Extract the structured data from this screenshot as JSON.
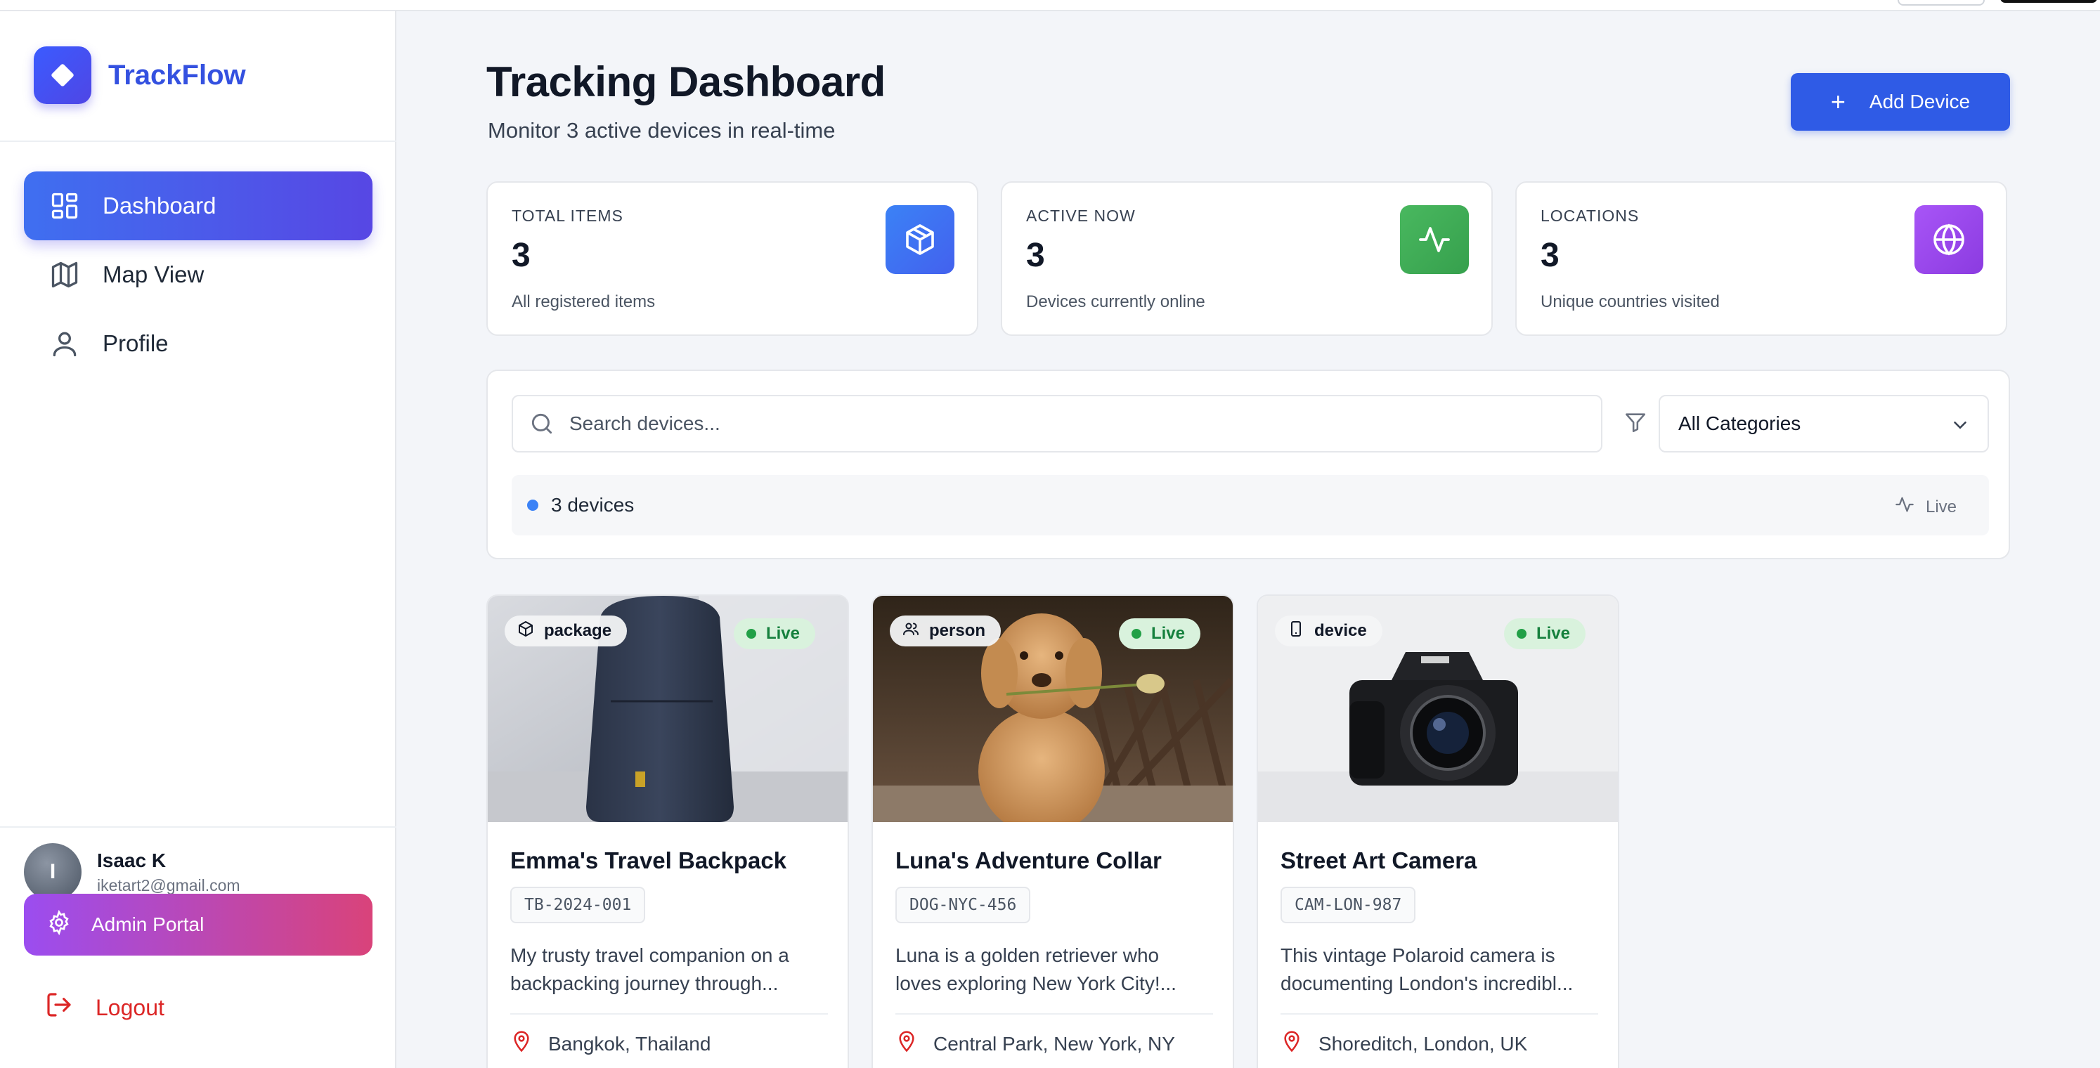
{
  "app": {
    "name": "TrackFlow"
  },
  "sidebar": {
    "items": [
      {
        "label": "Dashboard",
        "icon": "dashboard-grid-icon",
        "active": true
      },
      {
        "label": "Map View",
        "icon": "map-icon",
        "active": false
      },
      {
        "label": "Profile",
        "icon": "user-icon",
        "active": false
      }
    ],
    "user": {
      "initial": "I",
      "name": "Isaac K",
      "email": "iketart2@gmail.com"
    },
    "admin_label": "Admin Portal",
    "logout_label": "Logout"
  },
  "header": {
    "title": "Tracking Dashboard",
    "subtitle": "Monitor 3 active devices in real-time",
    "add_label": "Add Device"
  },
  "stats": [
    {
      "label": "TOTAL ITEMS",
      "value": "3",
      "desc": "All registered items",
      "icon": "package-icon",
      "color": "#3b6ff0"
    },
    {
      "label": "ACTIVE NOW",
      "value": "3",
      "desc": "Devices currently online",
      "icon": "activity-icon",
      "color": "#3fae57"
    },
    {
      "label": "LOCATIONS",
      "value": "3",
      "desc": "Unique countries visited",
      "icon": "globe-icon",
      "color": "#9d45e8"
    }
  ],
  "filters": {
    "search_placeholder": "Search devices...",
    "category": "All Categories",
    "count_text": "3 devices",
    "live_text": "Live"
  },
  "devices": [
    {
      "category": "package",
      "status": "Live",
      "title": "Emma's Travel Backpack",
      "code": "TB-2024-001",
      "desc_line1": "My trusty travel companion on a",
      "desc_line2": "backpacking journey through...",
      "location": "Bangkok, Thailand"
    },
    {
      "category": "person",
      "status": "Live",
      "title": "Luna's Adventure Collar",
      "code": "DOG-NYC-456",
      "desc_line1": "Luna is a golden retriever who",
      "desc_line2": "loves exploring New York City!...",
      "location": "Central Park, New York, NY"
    },
    {
      "category": "device",
      "status": "Live",
      "title": "Street Art Camera",
      "code": "CAM-LON-987",
      "desc_line1": "This vintage Polaroid camera is",
      "desc_line2": "documenting London's incredibl...",
      "location": "Shoreditch, London, UK"
    }
  ]
}
